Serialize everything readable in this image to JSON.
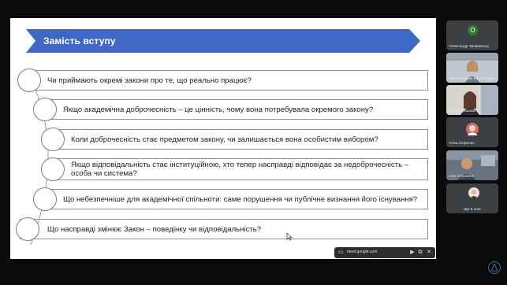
{
  "slide": {
    "title": "Замість вступу",
    "colors": {
      "banner": "#3e68c4"
    },
    "questions": [
      "Чи приймають окремі закони про те, що реально працює?",
      "Якщо академічна доброчесність – це цінність, чому вона потребувала окремого закону?",
      "Коли доброчесність стає предметом закону, чи залишається вона особистим вибором?",
      "Якщо відповідальність стає інституційною, хто тепер насправді відповідає за недоброчесність – особа чи система?",
      "Що небезпечніше для академічної спільноти: саме порушення чи публічне визнання його існування?",
      "Що насправді змінює Закон – поведінку чи відповідальність?"
    ]
  },
  "participants": [
    {
      "initial": "О",
      "name": "Олександр Трофимчук",
      "avatar_color": "#2e7d32"
    },
    {
      "initial": "",
      "name": "Olena Dudnyk Edu Programs",
      "avatar_color": ""
    },
    {
      "initial": "",
      "name": "Олеся Пешова",
      "avatar_color": ""
    },
    {
      "initial": "",
      "name": "Anna Osipenko",
      "avatar_color": ""
    },
    {
      "initial": "",
      "name": "Ілля Artyukhov",
      "avatar_color": ""
    },
    {
      "initial": "",
      "name": "Ще 6 осіб",
      "avatar_color": ""
    }
  ],
  "sharebar": {
    "url": "meet.google.com",
    "icons": [
      "screen-share-icon",
      "camera-icon",
      "screen-icon",
      "pip-icon",
      "close-icon"
    ]
  }
}
